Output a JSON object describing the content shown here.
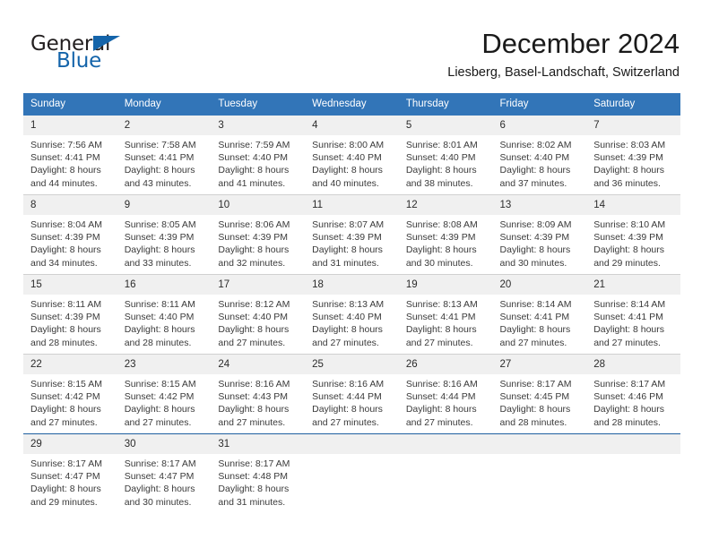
{
  "brand": {
    "word_one": "General",
    "word_two": "Blue",
    "triangle_icon": "brand-triangle-icon",
    "accent_color": "#1464aa"
  },
  "header": {
    "title": "December 2024",
    "subtitle": "Liesberg, Basel-Landschaft, Switzerland"
  },
  "calendar": {
    "header_bg": "#3275b8",
    "daynum_bg": "#f0f0f0",
    "weekdays": [
      "Sunday",
      "Monday",
      "Tuesday",
      "Wednesday",
      "Thursday",
      "Friday",
      "Saturday"
    ],
    "weeks": [
      [
        {
          "day": "1",
          "sunrise": "Sunrise: 7:56 AM",
          "sunset": "Sunset: 4:41 PM",
          "daylight_1": "Daylight: 8 hours",
          "daylight_2": "and 44 minutes."
        },
        {
          "day": "2",
          "sunrise": "Sunrise: 7:58 AM",
          "sunset": "Sunset: 4:41 PM",
          "daylight_1": "Daylight: 8 hours",
          "daylight_2": "and 43 minutes."
        },
        {
          "day": "3",
          "sunrise": "Sunrise: 7:59 AM",
          "sunset": "Sunset: 4:40 PM",
          "daylight_1": "Daylight: 8 hours",
          "daylight_2": "and 41 minutes."
        },
        {
          "day": "4",
          "sunrise": "Sunrise: 8:00 AM",
          "sunset": "Sunset: 4:40 PM",
          "daylight_1": "Daylight: 8 hours",
          "daylight_2": "and 40 minutes."
        },
        {
          "day": "5",
          "sunrise": "Sunrise: 8:01 AM",
          "sunset": "Sunset: 4:40 PM",
          "daylight_1": "Daylight: 8 hours",
          "daylight_2": "and 38 minutes."
        },
        {
          "day": "6",
          "sunrise": "Sunrise: 8:02 AM",
          "sunset": "Sunset: 4:40 PM",
          "daylight_1": "Daylight: 8 hours",
          "daylight_2": "and 37 minutes."
        },
        {
          "day": "7",
          "sunrise": "Sunrise: 8:03 AM",
          "sunset": "Sunset: 4:39 PM",
          "daylight_1": "Daylight: 8 hours",
          "daylight_2": "and 36 minutes."
        }
      ],
      [
        {
          "day": "8",
          "sunrise": "Sunrise: 8:04 AM",
          "sunset": "Sunset: 4:39 PM",
          "daylight_1": "Daylight: 8 hours",
          "daylight_2": "and 34 minutes."
        },
        {
          "day": "9",
          "sunrise": "Sunrise: 8:05 AM",
          "sunset": "Sunset: 4:39 PM",
          "daylight_1": "Daylight: 8 hours",
          "daylight_2": "and 33 minutes."
        },
        {
          "day": "10",
          "sunrise": "Sunrise: 8:06 AM",
          "sunset": "Sunset: 4:39 PM",
          "daylight_1": "Daylight: 8 hours",
          "daylight_2": "and 32 minutes."
        },
        {
          "day": "11",
          "sunrise": "Sunrise: 8:07 AM",
          "sunset": "Sunset: 4:39 PM",
          "daylight_1": "Daylight: 8 hours",
          "daylight_2": "and 31 minutes."
        },
        {
          "day": "12",
          "sunrise": "Sunrise: 8:08 AM",
          "sunset": "Sunset: 4:39 PM",
          "daylight_1": "Daylight: 8 hours",
          "daylight_2": "and 30 minutes."
        },
        {
          "day": "13",
          "sunrise": "Sunrise: 8:09 AM",
          "sunset": "Sunset: 4:39 PM",
          "daylight_1": "Daylight: 8 hours",
          "daylight_2": "and 30 minutes."
        },
        {
          "day": "14",
          "sunrise": "Sunrise: 8:10 AM",
          "sunset": "Sunset: 4:39 PM",
          "daylight_1": "Daylight: 8 hours",
          "daylight_2": "and 29 minutes."
        }
      ],
      [
        {
          "day": "15",
          "sunrise": "Sunrise: 8:11 AM",
          "sunset": "Sunset: 4:39 PM",
          "daylight_1": "Daylight: 8 hours",
          "daylight_2": "and 28 minutes."
        },
        {
          "day": "16",
          "sunrise": "Sunrise: 8:11 AM",
          "sunset": "Sunset: 4:40 PM",
          "daylight_1": "Daylight: 8 hours",
          "daylight_2": "and 28 minutes."
        },
        {
          "day": "17",
          "sunrise": "Sunrise: 8:12 AM",
          "sunset": "Sunset: 4:40 PM",
          "daylight_1": "Daylight: 8 hours",
          "daylight_2": "and 27 minutes."
        },
        {
          "day": "18",
          "sunrise": "Sunrise: 8:13 AM",
          "sunset": "Sunset: 4:40 PM",
          "daylight_1": "Daylight: 8 hours",
          "daylight_2": "and 27 minutes."
        },
        {
          "day": "19",
          "sunrise": "Sunrise: 8:13 AM",
          "sunset": "Sunset: 4:41 PM",
          "daylight_1": "Daylight: 8 hours",
          "daylight_2": "and 27 minutes."
        },
        {
          "day": "20",
          "sunrise": "Sunrise: 8:14 AM",
          "sunset": "Sunset: 4:41 PM",
          "daylight_1": "Daylight: 8 hours",
          "daylight_2": "and 27 minutes."
        },
        {
          "day": "21",
          "sunrise": "Sunrise: 8:14 AM",
          "sunset": "Sunset: 4:41 PM",
          "daylight_1": "Daylight: 8 hours",
          "daylight_2": "and 27 minutes."
        }
      ],
      [
        {
          "day": "22",
          "sunrise": "Sunrise: 8:15 AM",
          "sunset": "Sunset: 4:42 PM",
          "daylight_1": "Daylight: 8 hours",
          "daylight_2": "and 27 minutes."
        },
        {
          "day": "23",
          "sunrise": "Sunrise: 8:15 AM",
          "sunset": "Sunset: 4:42 PM",
          "daylight_1": "Daylight: 8 hours",
          "daylight_2": "and 27 minutes."
        },
        {
          "day": "24",
          "sunrise": "Sunrise: 8:16 AM",
          "sunset": "Sunset: 4:43 PM",
          "daylight_1": "Daylight: 8 hours",
          "daylight_2": "and 27 minutes."
        },
        {
          "day": "25",
          "sunrise": "Sunrise: 8:16 AM",
          "sunset": "Sunset: 4:44 PM",
          "daylight_1": "Daylight: 8 hours",
          "daylight_2": "and 27 minutes."
        },
        {
          "day": "26",
          "sunrise": "Sunrise: 8:16 AM",
          "sunset": "Sunset: 4:44 PM",
          "daylight_1": "Daylight: 8 hours",
          "daylight_2": "and 27 minutes."
        },
        {
          "day": "27",
          "sunrise": "Sunrise: 8:17 AM",
          "sunset": "Sunset: 4:45 PM",
          "daylight_1": "Daylight: 8 hours",
          "daylight_2": "and 28 minutes."
        },
        {
          "day": "28",
          "sunrise": "Sunrise: 8:17 AM",
          "sunset": "Sunset: 4:46 PM",
          "daylight_1": "Daylight: 8 hours",
          "daylight_2": "and 28 minutes."
        }
      ],
      [
        {
          "day": "29",
          "sunrise": "Sunrise: 8:17 AM",
          "sunset": "Sunset: 4:47 PM",
          "daylight_1": "Daylight: 8 hours",
          "daylight_2": "and 29 minutes."
        },
        {
          "day": "30",
          "sunrise": "Sunrise: 8:17 AM",
          "sunset": "Sunset: 4:47 PM",
          "daylight_1": "Daylight: 8 hours",
          "daylight_2": "and 30 minutes."
        },
        {
          "day": "31",
          "sunrise": "Sunrise: 8:17 AM",
          "sunset": "Sunset: 4:48 PM",
          "daylight_1": "Daylight: 8 hours",
          "daylight_2": "and 31 minutes."
        },
        {
          "day": "",
          "sunrise": "",
          "sunset": "",
          "daylight_1": "",
          "daylight_2": ""
        },
        {
          "day": "",
          "sunrise": "",
          "sunset": "",
          "daylight_1": "",
          "daylight_2": ""
        },
        {
          "day": "",
          "sunrise": "",
          "sunset": "",
          "daylight_1": "",
          "daylight_2": ""
        },
        {
          "day": "",
          "sunrise": "",
          "sunset": "",
          "daylight_1": "",
          "daylight_2": ""
        }
      ]
    ]
  }
}
